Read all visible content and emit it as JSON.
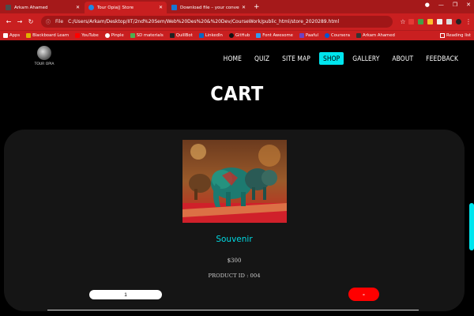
{
  "browser": {
    "tabs": [
      {
        "title": "Arkam Ahamed",
        "fav_color": "#4c4c4c"
      },
      {
        "title": "Tour Opia|| Store",
        "fav_color": "#1e88e5"
      },
      {
        "title": "Download file – your conversion",
        "fav_color": "#1976d2"
      }
    ],
    "new_tab": "+",
    "address": {
      "label": "File",
      "url": "C:/Users/Arkam/Desktop/IIT/2nd%20Sem/Web%20Des%20&%20Dev/CourseWork/public_html/store_2020289.html"
    },
    "bookmarks": [
      {
        "label": "Apps",
        "color": "#ffffff"
      },
      {
        "label": "Blackboard Learn",
        "color": "#e0b000"
      },
      {
        "label": "YouTube",
        "color": "#ff0000"
      },
      {
        "label": "Pinple",
        "color": "#ffffff"
      },
      {
        "label": "SD materials",
        "color": "#4caf50"
      },
      {
        "label": "QuillBot",
        "color": "#222222"
      },
      {
        "label": "LinkedIn",
        "color": "#0a66c2"
      },
      {
        "label": "GitHub",
        "color": "#111111"
      },
      {
        "label": "Font Awesome",
        "color": "#339af0"
      },
      {
        "label": "Paaful",
        "color": "#6f42c1"
      },
      {
        "label": "Coursera",
        "color": "#0056d2"
      },
      {
        "label": "Arkam Ahamed",
        "color": "#333333"
      }
    ],
    "reading_list": "Reading list"
  },
  "site": {
    "logo_text": "TOUR OPIA",
    "menu": [
      {
        "label": "HOME",
        "active": false
      },
      {
        "label": "QUIZ",
        "active": false
      },
      {
        "label": "SITE MAP",
        "active": false
      },
      {
        "label": "SHOP",
        "active": true
      },
      {
        "label": "GALLERY",
        "active": false
      },
      {
        "label": "ABOUT",
        "active": false
      },
      {
        "label": "FEEDBACK",
        "active": false
      }
    ],
    "accent": "#00e5ee"
  },
  "cart": {
    "title": "CART",
    "product": {
      "name": "Souvenir",
      "price": "$300",
      "product_id": "PRODUCT ID : 004",
      "quantity": "1",
      "remove_label": "-"
    }
  }
}
